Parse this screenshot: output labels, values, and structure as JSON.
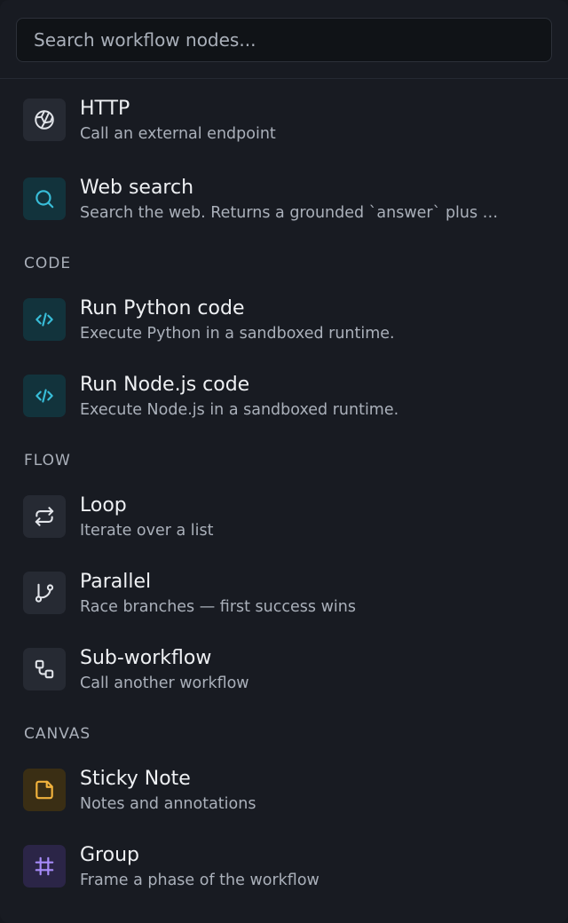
{
  "search": {
    "placeholder": "Search workflow nodes..."
  },
  "groups": {
    "code": "CODE",
    "flow": "FLOW",
    "canvas": "CANVAS"
  },
  "items": {
    "http": {
      "title": "HTTP",
      "desc": "Call an external endpoint",
      "icon": "globe-icon"
    },
    "web_search": {
      "title": "Web search",
      "desc": "Search the web. Returns a grounded `answer` plus …",
      "icon": "search-icon"
    },
    "python": {
      "title": "Run Python code",
      "desc": "Execute Python in a sandboxed runtime.",
      "icon": "code-icon"
    },
    "node": {
      "title": "Run Node.js code",
      "desc": "Execute Node.js in a sandboxed runtime.",
      "icon": "code-icon"
    },
    "loop": {
      "title": "Loop",
      "desc": "Iterate over a list",
      "icon": "repeat-icon"
    },
    "parallel": {
      "title": "Parallel",
      "desc": "Race branches — first success wins",
      "icon": "git-branch-icon"
    },
    "subworkflow": {
      "title": "Sub-workflow",
      "desc": "Call another workflow",
      "icon": "workflow-icon"
    },
    "sticky": {
      "title": "Sticky Note",
      "desc": "Notes and annotations",
      "icon": "sticky-note-icon"
    },
    "group": {
      "title": "Group",
      "desc": "Frame a phase of the workflow",
      "icon": "frame-icon"
    }
  },
  "colors": {
    "teal": "#38bdd8",
    "amber": "#f2b33d",
    "violet": "#a78bfa",
    "icon_neutral": "#e2e5ea"
  }
}
